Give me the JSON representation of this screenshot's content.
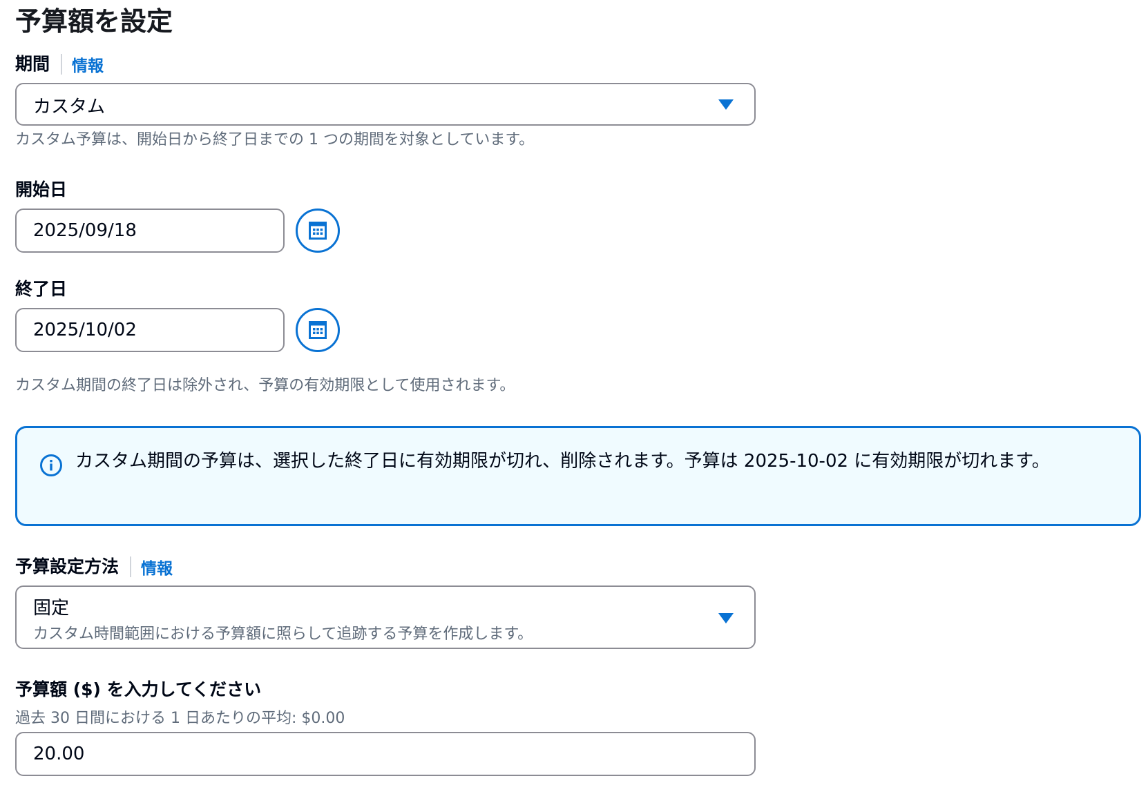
{
  "page": {
    "title": "予算額を設定"
  },
  "period": {
    "label": "期間",
    "info_link": "情報",
    "selected": "カスタム",
    "hint": "カスタム予算は、開始日から終了日までの 1 つの期間を対象としています。"
  },
  "start_date": {
    "label": "開始日",
    "value": "2025/09/18"
  },
  "end_date": {
    "label": "終了日",
    "value": "2025/10/02",
    "hint": "カスタム期間の終了日は除外され、予算の有効期限として使用されます。"
  },
  "alert": {
    "message": "カスタム期間の予算は、選択した終了日に有効期限が切れ、削除されます。予算は 2025-10-02 に有効期限が切れます。"
  },
  "method": {
    "label": "予算設定方法",
    "info_link": "情報",
    "selected": "固定",
    "description": "カスタム時間範囲における予算額に照らして追跡する予算を作成します。"
  },
  "amount": {
    "label": "予算額 ($) を入力してください",
    "helper": "過去 30 日間における 1 日あたりの平均: $0.00",
    "value": "20.00"
  },
  "colors": {
    "accent": "#0972d3",
    "alert_background": "#f0fbff",
    "muted_text": "#5f6b7a",
    "border": "#8c8c94"
  },
  "icons": {
    "select_caret": "caret-down-icon",
    "calendar": "calendar-icon",
    "info": "info-circle-icon"
  }
}
